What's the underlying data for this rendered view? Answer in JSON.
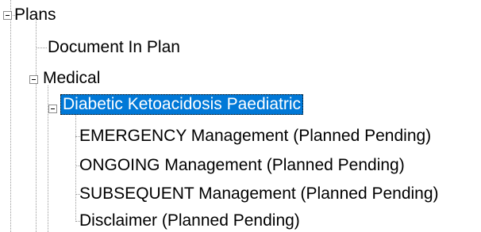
{
  "tree": {
    "root": {
      "label": "Plans",
      "expanded": true
    },
    "items": [
      {
        "label": "Document In Plan"
      },
      {
        "label": "Medical",
        "expanded": true,
        "children": [
          {
            "label": "Diabetic Ketoacidosis Paediatric",
            "expanded": true,
            "selected": true,
            "children": [
              {
                "label": "EMERGENCY Management (Planned Pending)"
              },
              {
                "label": "ONGOING Management (Planned Pending)"
              },
              {
                "label": "SUBSEQUENT Management (Planned Pending)"
              },
              {
                "label": "Disclaimer (Planned Pending)"
              }
            ]
          }
        ]
      }
    ],
    "selection_color": "#0078d7"
  },
  "icons": {
    "toggle": "collapse-minus-icon"
  }
}
